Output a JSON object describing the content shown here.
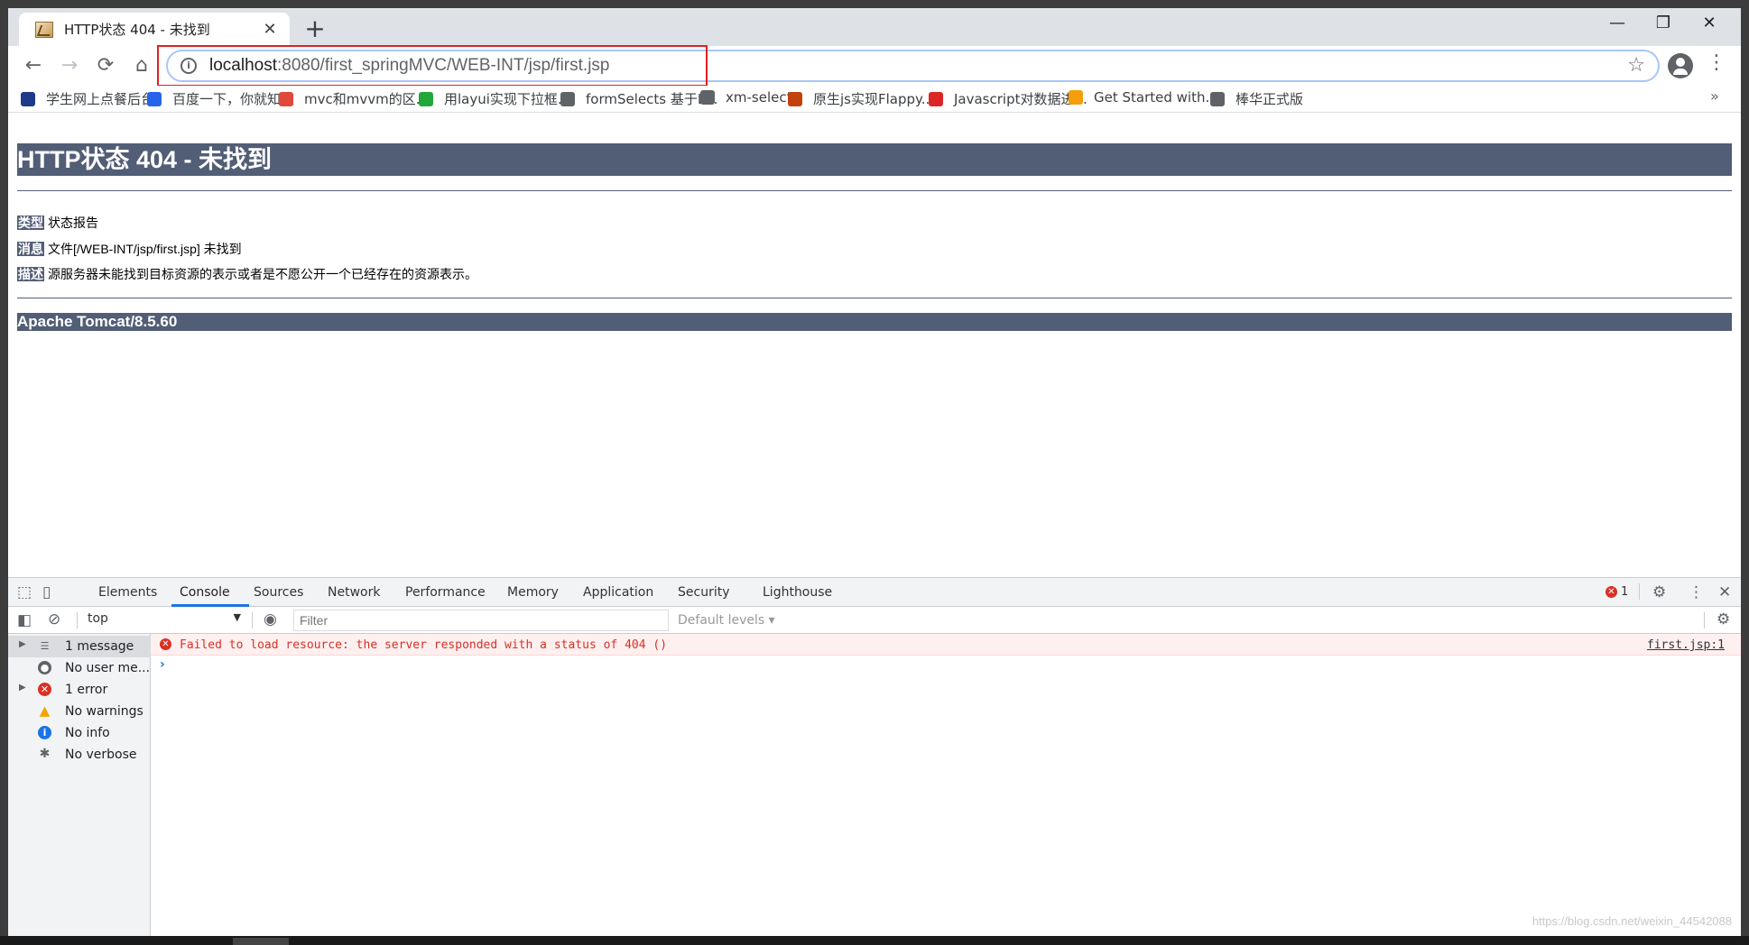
{
  "tab": {
    "title": "HTTP状态 404 - 未找到",
    "close": "✕",
    "new_tab": "+"
  },
  "window_controls": {
    "minimize": "—",
    "maximize": "❐",
    "close": "✕"
  },
  "toolbar": {
    "back": "←",
    "forward": "→",
    "reload": "⟳",
    "home": "⌂",
    "url_host": "localhost",
    "url_path": ":8080/first_springMVC/WEB-INT/jsp/first.jsp",
    "star": "☆",
    "menu": "⋮"
  },
  "bookmarks": [
    {
      "label": "学生网上点餐后台",
      "color": "#1e3a8a"
    },
    {
      "label": "百度一下，你就知道",
      "color": "#2563eb"
    },
    {
      "label": "mvc和mvvm的区...",
      "color": "#e0493a"
    },
    {
      "label": "用layui实现下拉框...",
      "color": "#22a83a"
    },
    {
      "label": "formSelects 基于L...",
      "color": "#5f6368"
    },
    {
      "label": "xm-select",
      "color": "#5f6368"
    },
    {
      "label": "原生js实现Flappy...",
      "color": "#c2410c"
    },
    {
      "label": "Javascript对数据进...",
      "color": "#dc2626"
    },
    {
      "label": "Get Started with...",
      "color": "#f59e0b"
    },
    {
      "label": "棒华正式版",
      "color": "#5f6368"
    }
  ],
  "bookmarks_more": "»",
  "page": {
    "heading": "HTTP状态 404 - 未找到",
    "rows": [
      {
        "label": "类型",
        "text": "状态报告"
      },
      {
        "label": "消息",
        "text": "文件[/WEB-INT/jsp/first.jsp] 未找到"
      },
      {
        "label": "描述",
        "text": "源服务器未能找到目标资源的表示或者是不愿公开一个已经存在的资源表示。"
      }
    ],
    "footer": "Apache Tomcat/8.5.60"
  },
  "devtools": {
    "tabs": [
      "Elements",
      "Console",
      "Sources",
      "Network",
      "Performance",
      "Memory",
      "Application",
      "Security",
      "Lighthouse"
    ],
    "error_count": "1",
    "context": "top",
    "filter_placeholder": "Filter",
    "levels": "Default levels",
    "sidebar": [
      {
        "label": "1 message",
        "icon": "list-icon"
      },
      {
        "label": "No user me...",
        "icon": "user-icon"
      },
      {
        "label": "1 error",
        "icon": "error-icon"
      },
      {
        "label": "No warnings",
        "icon": "warning-icon"
      },
      {
        "label": "No info",
        "icon": "info-icon"
      },
      {
        "label": "No verbose",
        "icon": "bug-icon"
      }
    ],
    "error_message": "Failed to load resource: the server responded with a status of 404 ()",
    "error_source": "first.jsp:1",
    "prompt": "›"
  },
  "watermark": "https://blog.csdn.net/weixin_44542088"
}
